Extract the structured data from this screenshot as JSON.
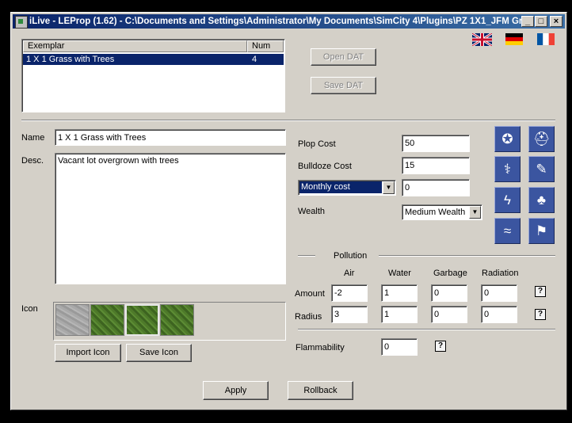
{
  "window": {
    "title": "iLive - LEProp (1.62) - C:\\Documents and Settings\\Administrator\\My Documents\\SimCity 4\\Plugins\\PZ 1X1_JFM Gr...",
    "controls": [
      "_",
      "□",
      "×"
    ]
  },
  "languages": [
    {
      "name": "flag-uk-icon",
      "colors": [
        "#012169",
        "#c8102e",
        "#ffffff"
      ]
    },
    {
      "name": "flag-germany-icon",
      "colors": [
        "#000000",
        "#dd0000",
        "#ffce00"
      ]
    },
    {
      "name": "flag-france-icon",
      "colors": [
        "#0055a4",
        "#ffffff",
        "#ef4135"
      ]
    }
  ],
  "exemplar_list": {
    "columns": [
      "Exemplar",
      "Num"
    ],
    "rows": [
      {
        "exemplar": "1 X 1 Grass with Trees",
        "num": "4"
      }
    ]
  },
  "buttons": {
    "open_dat": "Open DAT",
    "save_dat": "Save DAT",
    "import_icon": "Import Icon",
    "save_icon": "Save Icon",
    "apply": "Apply",
    "rollback": "Rollback"
  },
  "fields": {
    "name_label": "Name",
    "name_value": "1 X 1 Grass with Trees",
    "desc_label": "Desc.",
    "desc_value": "Vacant lot overgrown with trees",
    "icon_label": "Icon"
  },
  "costs": {
    "plop_label": "Plop Cost",
    "plop_value": "50",
    "bulldoze_label": "Bulldoze Cost",
    "bulldoze_value": "15",
    "monthly_select": "Monthly cost",
    "monthly_value": "0",
    "wealth_label": "Wealth",
    "wealth_value": "Medium Wealth"
  },
  "pollution": {
    "section_label": "Pollution",
    "columns": [
      "Air",
      "Water",
      "Garbage",
      "Radiation"
    ],
    "amount_label": "Amount",
    "amount_values": [
      "-2",
      "1",
      "0",
      "0"
    ],
    "radius_label": "Radius",
    "radius_values": [
      "3",
      "1",
      "0",
      "0"
    ]
  },
  "flammability": {
    "label": "Flammability",
    "value": "0"
  },
  "help_glyph": "?",
  "tool_icons": [
    "police-icon",
    "fire-icon",
    "health-icon",
    "education-icon",
    "power-icon",
    "park-icon",
    "water-icon",
    "landmark-icon"
  ],
  "icon_swatches": [
    "rock",
    "grass",
    "grass",
    "grass"
  ]
}
